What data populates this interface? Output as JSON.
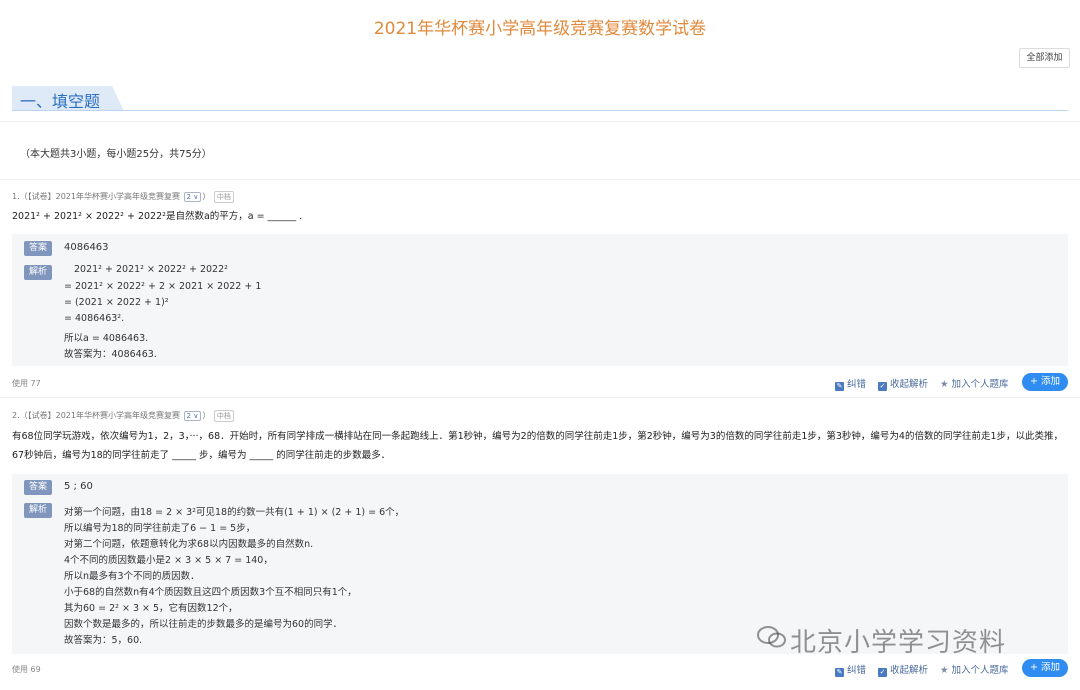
{
  "page": {
    "title": "2021年华杯赛小学高年级竞赛复赛数学试卷",
    "add_all_label": "全部添加"
  },
  "section": {
    "label": "一、填空题",
    "desc": "（本大题共3小题，每小题25分，共75分）"
  },
  "questions": [
    {
      "meta_prefix": "1.（【试卷】2021年华杯赛小学高年级竞赛复赛",
      "level": "2",
      "meta_suffix": "）",
      "difficulty": "中档",
      "text": "2021² + 2021² × 2022² + 2022²是自然数a的平方，a = ______ .",
      "answer_label": "答案",
      "answer": "4086463",
      "analysis_label": "解析",
      "analysis_lines": [
        "2021² + 2021² × 2022² + 2022²",
        "= 2021² × 2022² + 2 × 2021 × 2022 + 1",
        "= (2021 × 2022 + 1)²",
        "= 4086463².",
        "所以a = 4086463.",
        "故答案为：4086463."
      ],
      "usage": "使用 77",
      "actions": {
        "correct": "纠错",
        "collapse": "收起解析",
        "add_personal": "加入个人题库",
        "add": "+ 添加"
      }
    },
    {
      "meta_prefix": "2.（【试卷】2021年华杯赛小学高年级竞赛复赛",
      "level": "2",
      "meta_suffix": "）",
      "difficulty": "中档",
      "text": "有68位同学玩游戏，依次编号为1，2，3，···，68．开始时，所有同学排成一横排站在同一条起跑线上．第1秒钟，编号为2的倍数的同学往前走1步，第2秒钟，编号为3的倍数的同学往前走1步，第3秒钟，编号为4的倍数的同学往前走1步，以此类推，67秒钟后，编号为18的同学往前走了 _____ 步，编号为 _____ 的同学往前走的步数最多．",
      "answer_label": "答案",
      "answer": "5 ; 60",
      "analysis_label": "解析",
      "analysis_lines": [
        "对第一个问题，由18 = 2 × 3²可见18的约数一共有(1 + 1) × (2 + 1) = 6个，",
        "所以编号为18的同学往前走了6 − 1 = 5步，",
        "对第二个问题，依题意转化为求68以内因数最多的自然数n.",
        "4个不同的质因数最小是2 × 3 × 5 × 7 = 140，",
        "所以n最多有3个不同的质因数．",
        "小于68的自然数n有4个质因数且这四个质因数3个互不相同只有1个，",
        "其为60 = 2² × 3 × 5，它有因数12个，",
        "因数个数是最多的，所以往前走的步数最多的是编号为60的同学．",
        "故答案为：5，60."
      ],
      "usage": "使用 69",
      "actions": {
        "correct": "纠错",
        "collapse": "收起解析",
        "add_personal": "加入个人题库",
        "add": "+ 添加"
      }
    }
  ],
  "watermark": "北京小学学习资料"
}
